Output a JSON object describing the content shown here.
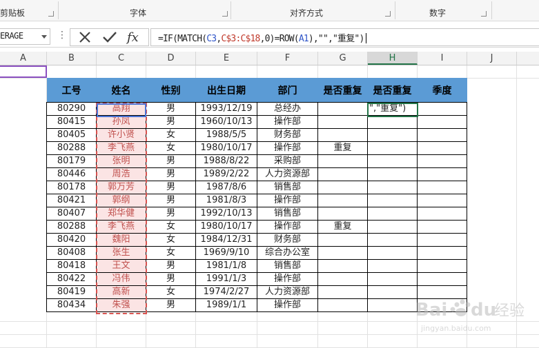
{
  "ribbon": {
    "groups": [
      "剪贴板",
      "字体",
      "对齐方式",
      "数字"
    ]
  },
  "formula_bar": {
    "name_box": "AVERAGE",
    "name_box_visible": "ERAGE",
    "cancel_icon": "x-icon",
    "enter_icon": "check-icon",
    "function_icon": "fx-icon",
    "formula": "=IF(MATCH(C3,C$3:C$18,0)=ROW(A1),\"\",\"重复\")",
    "formula_parts": {
      "p1": "=IF(MATCH(",
      "p2": "C3",
      "p3": ",",
      "p4": "C$3:C$18",
      "p5": ",0)=ROW(",
      "p6": "A1",
      "p7": "),\"\",\"重复\")"
    }
  },
  "columns": [
    "A",
    "B",
    "C",
    "D",
    "E",
    "F",
    "G",
    "H",
    "I",
    "J"
  ],
  "active_column": "H",
  "table": {
    "headers": [
      "工号",
      "姓名",
      "性别",
      "出生日期",
      "部门",
      "是否重复",
      "是否重复",
      "季度"
    ],
    "rows": [
      [
        "80290",
        "高翔",
        "男",
        "1993/12/19",
        "总经办",
        "",
        "\",\"重复\")",
        ""
      ],
      [
        "80415",
        "孙凤",
        "男",
        "1960/10/13",
        "操作部",
        "",
        "",
        ""
      ],
      [
        "80405",
        "许小贤",
        "女",
        "1988/5/5",
        "财务部",
        "",
        "",
        ""
      ],
      [
        "80288",
        "李飞燕",
        "女",
        "1980/10/17",
        "操作部",
        "重复",
        "",
        ""
      ],
      [
        "80179",
        "张明",
        "男",
        "1988/8/22",
        "采购部",
        "",
        "",
        ""
      ],
      [
        "80446",
        "周浩",
        "男",
        "1989/2/22",
        "人力资源部",
        "",
        "",
        ""
      ],
      [
        "80178",
        "郭万芳",
        "男",
        "1987/8/6",
        "销售部",
        "",
        "",
        ""
      ],
      [
        "80421",
        "郭纲",
        "男",
        "1981/8/3",
        "操作部",
        "",
        "",
        ""
      ],
      [
        "80407",
        "郑华健",
        "男",
        "1992/10/13",
        "销售部",
        "",
        "",
        ""
      ],
      [
        "80288",
        "李飞燕",
        "女",
        "1980/10/17",
        "操作部",
        "重复",
        "",
        ""
      ],
      [
        "80420",
        "魏阳",
        "女",
        "1984/12/31",
        "财务部",
        "",
        "",
        ""
      ],
      [
        "80408",
        "张生",
        "女",
        "1969/9/10",
        "综合办公室",
        "",
        "",
        ""
      ],
      [
        "80418",
        "王文",
        "男",
        "1981/1/8",
        "销售部",
        "",
        "",
        ""
      ],
      [
        "80422",
        "冯伟",
        "男",
        "1991/1/3",
        "操作部",
        "",
        "",
        ""
      ],
      [
        "80419",
        "高新",
        "女",
        "1974/2/27",
        "人力资源部",
        "",
        "",
        ""
      ],
      [
        "80434",
        "朱强",
        "男",
        "1989/1/1",
        "操作部",
        "",
        "",
        ""
      ]
    ]
  },
  "watermark": {
    "text": "Baidu 经验",
    "subtext": "jingyan.baidu.com"
  },
  "colors": {
    "header_fill": "#5b9bd5",
    "name_fill": "#fbe4e4",
    "active_green": "#217346",
    "copy_border": "#d9534f",
    "ref_blue": "#4a74d6"
  }
}
